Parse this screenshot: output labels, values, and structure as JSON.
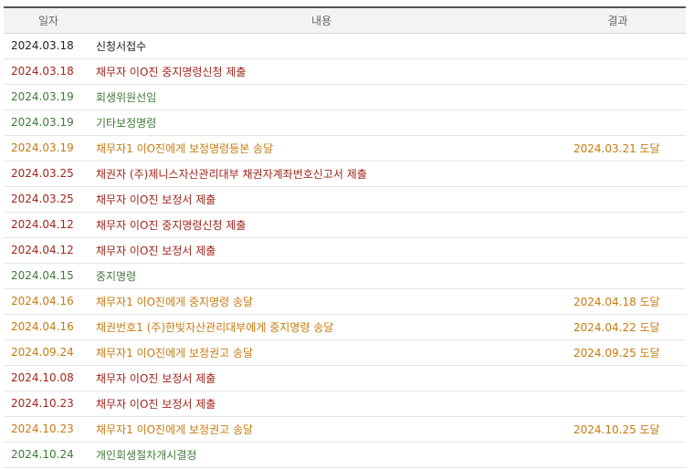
{
  "header": {
    "date": "일자",
    "content": "내용",
    "result": "결과"
  },
  "colors": {
    "black": "#222222",
    "red": "#a0261c",
    "green": "#3f7a36",
    "orange": "#c77a12"
  },
  "rows": [
    {
      "date": "2024.03.18",
      "content": "신청서접수",
      "result": "",
      "color": "black"
    },
    {
      "date": "2024.03.18",
      "content": "채무자 이O진 중지명령신청 제출",
      "result": "",
      "color": "red"
    },
    {
      "date": "2024.03.19",
      "content": "회생위원선임",
      "result": "",
      "color": "green"
    },
    {
      "date": "2024.03.19",
      "content": "기타보정명령",
      "result": "",
      "color": "green"
    },
    {
      "date": "2024.03.19",
      "content": "채무자1 이O진에게 보정명령등본 송달",
      "result": "2024.03.21 도달",
      "color": "orange"
    },
    {
      "date": "2024.03.25",
      "content": "채권자 (주)제니스자산관리대부 채권자계좌번호신고서 제출",
      "result": "",
      "color": "red"
    },
    {
      "date": "2024.03.25",
      "content": "채무자 이O진 보정서 제출",
      "result": "",
      "color": "red"
    },
    {
      "date": "2024.04.12",
      "content": "채무자 이O진 중지명령신청 제출",
      "result": "",
      "color": "red"
    },
    {
      "date": "2024.04.12",
      "content": "채무자 이O진 보정서 제출",
      "result": "",
      "color": "red"
    },
    {
      "date": "2024.04.15",
      "content": "중지명령",
      "result": "",
      "color": "green"
    },
    {
      "date": "2024.04.16",
      "content": "채무자1 이O진에게 중지명령 송달",
      "result": "2024.04.18 도달",
      "color": "orange"
    },
    {
      "date": "2024.04.16",
      "content": "채권번호1 (주)한빛자산관리대부에게 중지명령 송달",
      "result": "2024.04.22 도달",
      "color": "orange"
    },
    {
      "date": "2024.09.24",
      "content": "채무자1 이O진에게 보정권고 송달",
      "result": "2024.09.25 도달",
      "color": "orange"
    },
    {
      "date": "2024.10.08",
      "content": "채무자 이O진 보정서 제출",
      "result": "",
      "color": "red"
    },
    {
      "date": "2024.10.23",
      "content": "채무자 이O진 보정서 제출",
      "result": "",
      "color": "red"
    },
    {
      "date": "2024.10.23",
      "content": "채무자1 이O진에게 보정권고 송달",
      "result": "2024.10.25 도달",
      "color": "orange"
    },
    {
      "date": "2024.10.24",
      "content": "개인회생절차개시결정",
      "result": "",
      "color": "green"
    }
  ]
}
